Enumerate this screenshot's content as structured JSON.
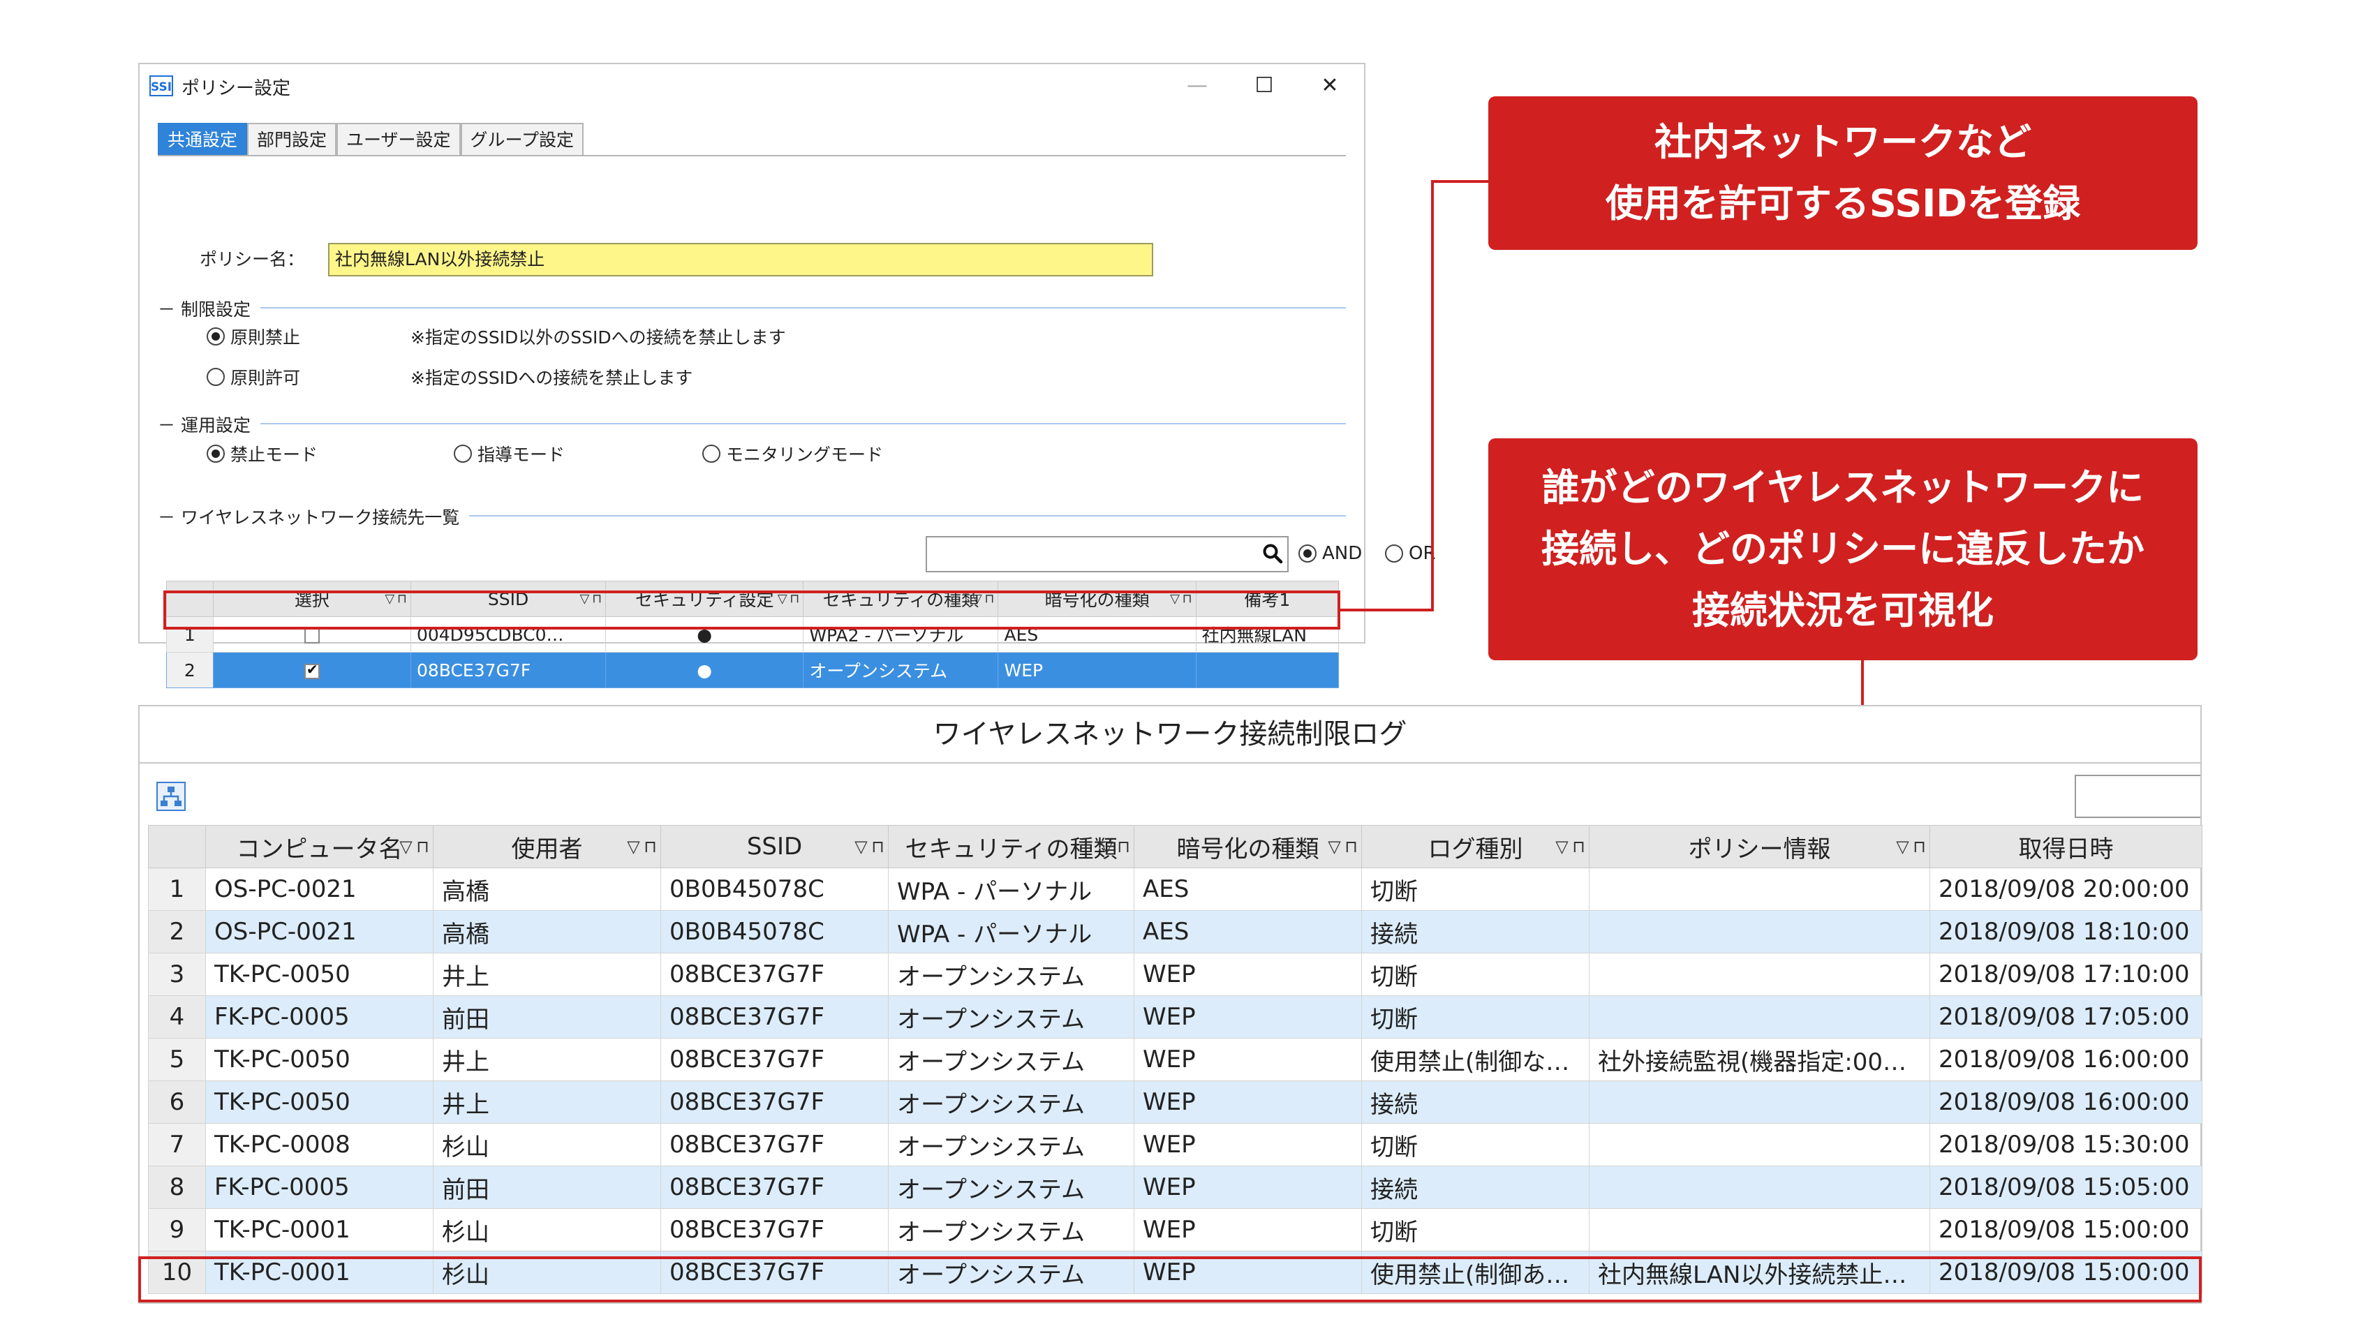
{
  "policy_window": {
    "app_icon": "SSI",
    "title": "ポリシー設定",
    "controls": {
      "minimize": "—",
      "maximize": "☐",
      "close": "✕"
    },
    "tabs": [
      "共通設定",
      "部門設定",
      "ユーザー設定",
      "グループ設定"
    ],
    "policy_name_label": "ポリシー名：",
    "policy_name_value": "社内無線LAN以外接続禁止",
    "restriction": {
      "section": "制限設定",
      "options": [
        {
          "label": "原則禁止",
          "note": "※指定のSSID以外のSSIDへの接続を禁止します",
          "selected": true
        },
        {
          "label": "原則許可",
          "note": "※指定のSSIDへの接続を禁止します",
          "selected": false
        }
      ]
    },
    "operation": {
      "section": "運用設定",
      "options": [
        {
          "label": "禁止モード",
          "selected": true
        },
        {
          "label": "指導モード",
          "selected": false
        },
        {
          "label": "モニタリングモード",
          "selected": false
        }
      ]
    },
    "wireless_list": {
      "section": "ワイヤレスネットワーク接続先一覧",
      "search_placeholder": "",
      "and_label": "AND",
      "or_label": "OR",
      "filter_glyph": "▽ ⊓",
      "columns": [
        "選択",
        "SSID",
        "セキュリティ設定",
        "セキュリティの種類",
        "暗号化の種類",
        "備考1"
      ],
      "rows": [
        {
          "no": "1",
          "checked": false,
          "ssid": "004D95CDBC0…",
          "security": "●",
          "sec_type": "WPA2 - パーソナル",
          "enc": "AES",
          "note": "社内無線LAN"
        },
        {
          "no": "2",
          "checked": true,
          "ssid": "08BCE37G7F",
          "security": "●",
          "sec_type": "オープンシステム",
          "enc": "WEP",
          "note": ""
        }
      ]
    }
  },
  "callouts": [
    {
      "lines": [
        "社内ネットワークなど",
        "使用を許可するSSIDを登録"
      ]
    },
    {
      "lines": [
        "誰がどのワイヤレスネットワークに",
        "接続し、どのポリシーに違反したか",
        "接続状況を可視化"
      ]
    }
  ],
  "log": {
    "title": "ワイヤレスネットワーク接続制限ログ",
    "icon": "network-tree-icon",
    "columns": [
      "コンピュータ名",
      "使用者",
      "SSID",
      "セキュリティの種類",
      "暗号化の種類",
      "ログ種別",
      "ポリシー情報",
      "取得日時"
    ],
    "rows": [
      {
        "no": "1",
        "pc": "OS-PC-0021",
        "user": "高橋",
        "ssid": "0B0B45078C",
        "sec": "WPA - パーソナル",
        "enc": "AES",
        "kind": "切断",
        "policy": "",
        "time": "2018/09/08 20:00:00"
      },
      {
        "no": "2",
        "pc": "OS-PC-0021",
        "user": "高橋",
        "ssid": "0B0B45078C",
        "sec": "WPA - パーソナル",
        "enc": "AES",
        "kind": "接続",
        "policy": "",
        "time": "2018/09/08 18:10:00"
      },
      {
        "no": "3",
        "pc": "TK-PC-0050",
        "user": "井上",
        "ssid": "08BCE37G7F",
        "sec": "オープンシステム",
        "enc": "WEP",
        "kind": "切断",
        "policy": "",
        "time": "2018/09/08 17:10:00"
      },
      {
        "no": "4",
        "pc": "FK-PC-0005",
        "user": "前田",
        "ssid": "08BCE37G7F",
        "sec": "オープンシステム",
        "enc": "WEP",
        "kind": "切断",
        "policy": "",
        "time": "2018/09/08 17:05:00"
      },
      {
        "no": "5",
        "pc": "TK-PC-0050",
        "user": "井上",
        "ssid": "08BCE37G7F",
        "sec": "オープンシステム",
        "enc": "WEP",
        "kind": "使用禁止(制御な…",
        "policy": "社外接続監視(機器指定:00…",
        "time": "2018/09/08 16:00:00"
      },
      {
        "no": "6",
        "pc": "TK-PC-0050",
        "user": "井上",
        "ssid": "08BCE37G7F",
        "sec": "オープンシステム",
        "enc": "WEP",
        "kind": "接続",
        "policy": "",
        "time": "2018/09/08 16:00:00"
      },
      {
        "no": "7",
        "pc": "TK-PC-0008",
        "user": "杉山",
        "ssid": "08BCE37G7F",
        "sec": "オープンシステム",
        "enc": "WEP",
        "kind": "切断",
        "policy": "",
        "time": "2018/09/08 15:30:00"
      },
      {
        "no": "8",
        "pc": "FK-PC-0005",
        "user": "前田",
        "ssid": "08BCE37G7F",
        "sec": "オープンシステム",
        "enc": "WEP",
        "kind": "接続",
        "policy": "",
        "time": "2018/09/08 15:05:00"
      },
      {
        "no": "9",
        "pc": "TK-PC-0001",
        "user": "杉山",
        "ssid": "08BCE37G7F",
        "sec": "オープンシステム",
        "enc": "WEP",
        "kind": "切断",
        "policy": "",
        "time": "2018/09/08 15:00:00"
      },
      {
        "no": "10",
        "pc": "TK-PC-0001",
        "user": "杉山",
        "ssid": "08BCE37G7F",
        "sec": "オープンシステム",
        "enc": "WEP",
        "kind": "使用禁止(制御あ…",
        "policy": "社内無線LAN以外接続禁止…",
        "time": "2018/09/08 15:00:00"
      }
    ]
  }
}
